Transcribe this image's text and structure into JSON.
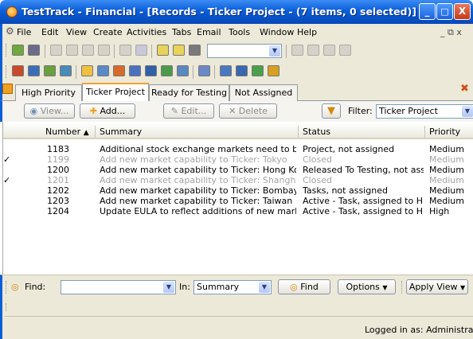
{
  "window": {
    "title": "TestTrack - Financial - [Records - Ticker Project - (7 items, 0 selected)]",
    "controls": {
      "minimize": "_",
      "maximize": "□",
      "close": "X"
    }
  },
  "menu": {
    "items": [
      "File",
      "Edit",
      "View",
      "Create",
      "Activities",
      "Tabs",
      "Email",
      "Tools",
      "Window",
      "Help"
    ],
    "mdi_controls": "_ ⧉ x"
  },
  "toolbar": {
    "icons": [
      "gear-icon",
      "save-icon",
      "wand-icon",
      "cut-icon",
      "copy-icon",
      "undo-icon",
      "check-icon",
      "folder-icon",
      "link-icon",
      "link2-icon",
      "grid-icon",
      "chevron-down-icon",
      "find-icon",
      "browse-icon",
      "save2-icon",
      "save3-icon"
    ]
  },
  "tabs": {
    "items": [
      "High Priority",
      "Ticker Project",
      "Ready for Testing",
      "Not Assigned"
    ],
    "active_index": 1
  },
  "actions": {
    "view": "View...",
    "add": "Add...",
    "edit": "Edit...",
    "delete": "Delete",
    "filter_label": "Filter:",
    "filter_value": "Ticker Project"
  },
  "grid": {
    "columns": [
      "Number",
      "Summary",
      "Status",
      "Priority"
    ],
    "sort_indicator": "▲",
    "rows": [
      {
        "check": "",
        "number": "1183",
        "summary": "Additional stock exchange markets need to be ad...",
        "status": "Project, not assigned",
        "priority": "Medium",
        "closed": false
      },
      {
        "check": "✓",
        "number": "1199",
        "summary": "Add new market capability to Ticker: Tokyo",
        "status": "Closed",
        "priority": "Medium",
        "closed": true
      },
      {
        "check": "",
        "number": "1200",
        "summary": "Add new market capability to Ticker: Hong Kong",
        "status": "Released To Testing, not assi...",
        "priority": "Medium",
        "closed": false
      },
      {
        "check": "✓",
        "number": "1201",
        "summary": "Add new market capability to Ticker: Shanghai",
        "status": "Closed",
        "priority": "Medium",
        "closed": true
      },
      {
        "check": "",
        "number": "1202",
        "summary": "Add new market capability to Ticker: Bombay",
        "status": "Tasks, not assigned",
        "priority": "Medium",
        "closed": false
      },
      {
        "check": "",
        "number": "1203",
        "summary": "Add new market capability to Ticker: Taiwan",
        "status": "Active - Task, assigned to Hir...",
        "priority": "Medium",
        "closed": false
      },
      {
        "check": "",
        "number": "1204",
        "summary": "Update EULA to reflect additions of new markets, ...",
        "status": "Active - Task, assigned to Hir...",
        "priority": "High",
        "closed": false
      }
    ]
  },
  "find": {
    "label": "Find:",
    "value": "",
    "in_label": "In:",
    "in_value": "Summary",
    "find_button": "Find",
    "options_button": "Options",
    "apply_view_button": "Apply View"
  },
  "status": {
    "logged_in": "Logged in as: Administrator"
  },
  "colors": {
    "titlebar": "#0a5fd8",
    "chrome": "#ece9d8",
    "closed_text": "#a3a3a3",
    "tab_accent": "#f0a030"
  }
}
